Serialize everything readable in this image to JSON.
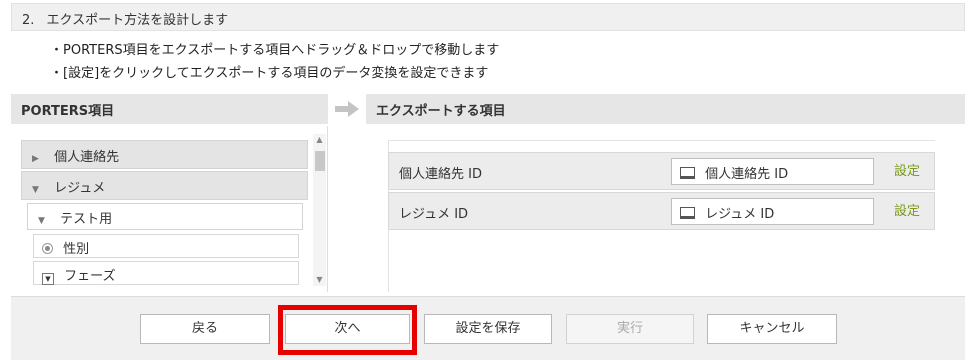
{
  "step": {
    "number": "2.",
    "title": "エクスポート方法を設計します"
  },
  "instructions": [
    "・PORTERS項目をエクスポートする項目へドラッグ＆ドロップで移動します",
    "・[設定]をクリックしてエクスポートする項目のデータ変換を設定できます"
  ],
  "left_pane": {
    "title": "PORTERS項目",
    "groups": [
      {
        "label": "個人連絡先",
        "state": "collapsed"
      },
      {
        "label": "レジュメ",
        "state": "expanded"
      }
    ],
    "subgroup": {
      "label": "テスト用",
      "state": "expanded"
    },
    "fields": [
      {
        "label": "性別",
        "icon": "radio-icon"
      },
      {
        "label": "フェーズ",
        "icon": "select-icon"
      }
    ]
  },
  "right_pane": {
    "title": "エクスポートする項目",
    "rows": [
      {
        "label": "個人連絡先 ID",
        "value": "個人連絡先 ID",
        "setting": "設定"
      },
      {
        "label": "レジュメ ID",
        "value": "レジュメ ID",
        "setting": "設定"
      }
    ]
  },
  "buttons": {
    "back": "戻る",
    "next": "次へ",
    "save": "設定を保存",
    "run": "実行",
    "cancel": "キャンセル"
  },
  "colors": {
    "highlight": "#e60000",
    "setting_link": "#7a9a1e"
  }
}
